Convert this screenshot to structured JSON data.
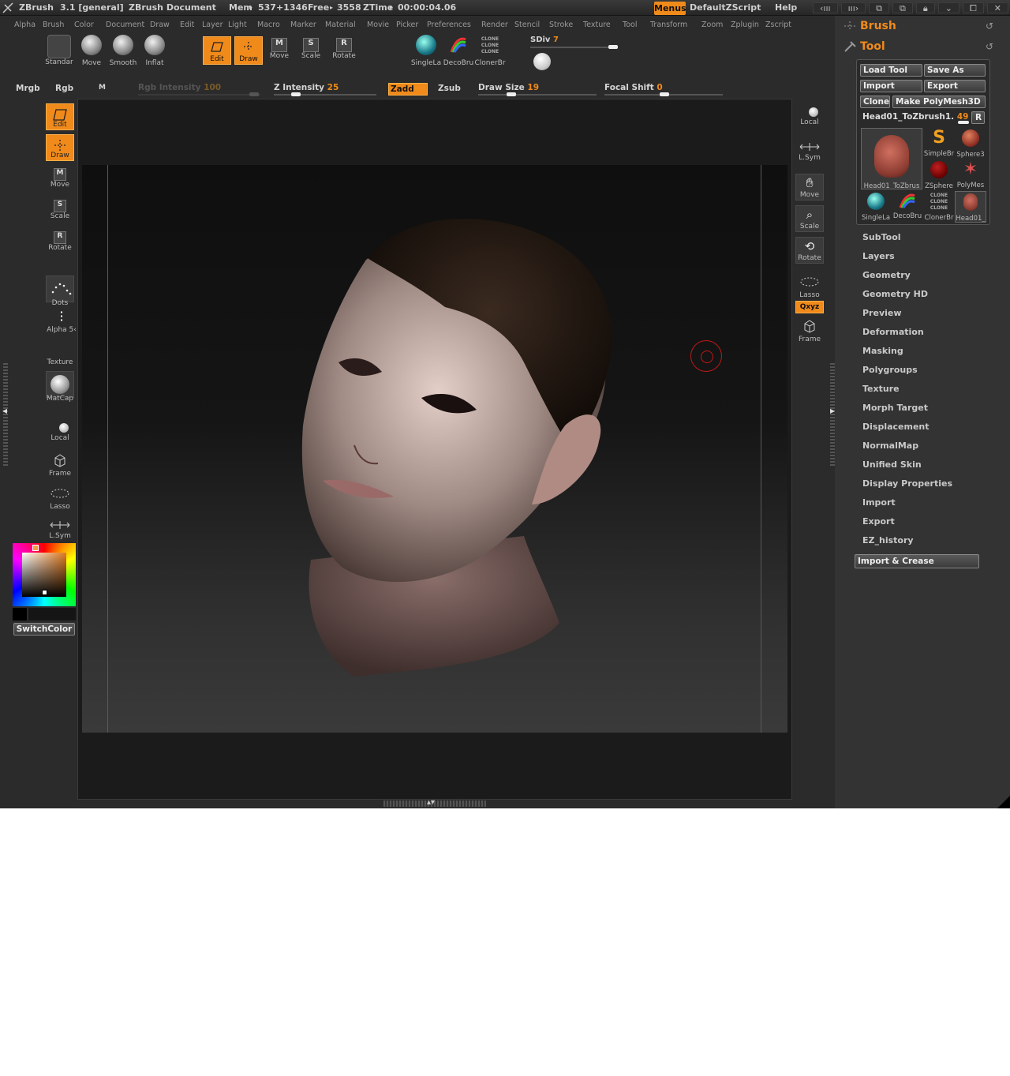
{
  "titlebar": {
    "app": "ZBrush",
    "version": "3.1 [general]",
    "document": "ZBrush Document",
    "mem_label": "Mem",
    "mem_value": "537+1346",
    "free_label": "Free",
    "free_value": "3558",
    "ztime_label": "ZTime",
    "ztime_value": "00:00:04.06",
    "menus": "Menus",
    "script": "DefaultZScript",
    "help": "Help"
  },
  "menubar": [
    "Alpha",
    "Brush",
    "Color",
    "Document",
    "Draw",
    "Edit",
    "Layer",
    "Light",
    "Macro",
    "Marker",
    "Material",
    "Movie",
    "Picker",
    "Preferences",
    "Render",
    "Stencil",
    "Stroke",
    "Texture",
    "Tool",
    "Transform",
    "Zoom",
    "Zplugin",
    "Zscript"
  ],
  "toolbar": {
    "brushes": [
      "Standar",
      "Move",
      "Smooth",
      "Inflat"
    ],
    "edit": "Edit",
    "draw": "Draw",
    "move": "Move",
    "scale": "Scale",
    "rotate": "Rotate",
    "tools": [
      "SingleLa",
      "DecoBru",
      "ClonerBr"
    ],
    "sdiv_label": "SDiv",
    "sdiv_value": "7"
  },
  "strip": {
    "mrgb": "Mrgb",
    "rgb": "Rgb",
    "m": "M",
    "rgb_intensity_label": "Rgb Intensity",
    "rgb_intensity_value": "100",
    "z_intensity_label": "Z Intensity",
    "z_intensity_value": "25",
    "zadd": "Zadd",
    "zsub": "Zsub",
    "draw_size_label": "Draw Size",
    "draw_size_value": "19",
    "focal_shift_label": "Focal Shift",
    "focal_shift_value": "0"
  },
  "left_shelf": {
    "edit": "Edit",
    "draw": "Draw",
    "move": "Move",
    "scale": "Scale",
    "rotate": "Rotate",
    "dots": "Dots",
    "alpha": "Alpha 5‹",
    "texture": "Texture",
    "matcap": "MatCap",
    "local": "Local",
    "frame": "Frame",
    "lasso": "Lasso",
    "lsym": "L.Sym",
    "switchcolor": "SwitchColor"
  },
  "right_shelf": {
    "local": "Local",
    "lsym": "L.Sym",
    "move": "Move",
    "scale": "Scale",
    "rotate": "Rotate",
    "lasso": "Lasso",
    "xyz": "Qxyz",
    "frame": "Frame"
  },
  "palette": {
    "brush_title": "Brush",
    "tool_title": "Tool",
    "load_tool": "Load Tool",
    "save_as": "Save As",
    "import": "Import",
    "export": "Export",
    "clone": "Clone",
    "make_polymesh": "Make PolyMesh3D",
    "current_tool": "Head01_ToZbrush1.",
    "current_tool_count": "49",
    "r": "R",
    "thumbs": [
      "Head01_ToZbrus",
      "SimpleBr",
      "Sphere3",
      "ZSphere",
      "PolyMes",
      "SingleLa",
      "DecoBru",
      "ClonerBr",
      "Head01_"
    ],
    "subpalettes": [
      "SubTool",
      "Layers",
      "Geometry",
      "Geometry HD",
      "Preview",
      "Deformation",
      "Masking",
      "Polygroups",
      "Texture",
      "Morph Target",
      "Displacement",
      "NormalMap",
      "Unified Skin",
      "Display Properties",
      "Import",
      "Export",
      "EZ_history"
    ],
    "import_crease": "Import & Crease"
  },
  "colors": {
    "accent": "#f08a1a",
    "background": "#2b2b2b",
    "canvas": "#1b1b1b"
  }
}
